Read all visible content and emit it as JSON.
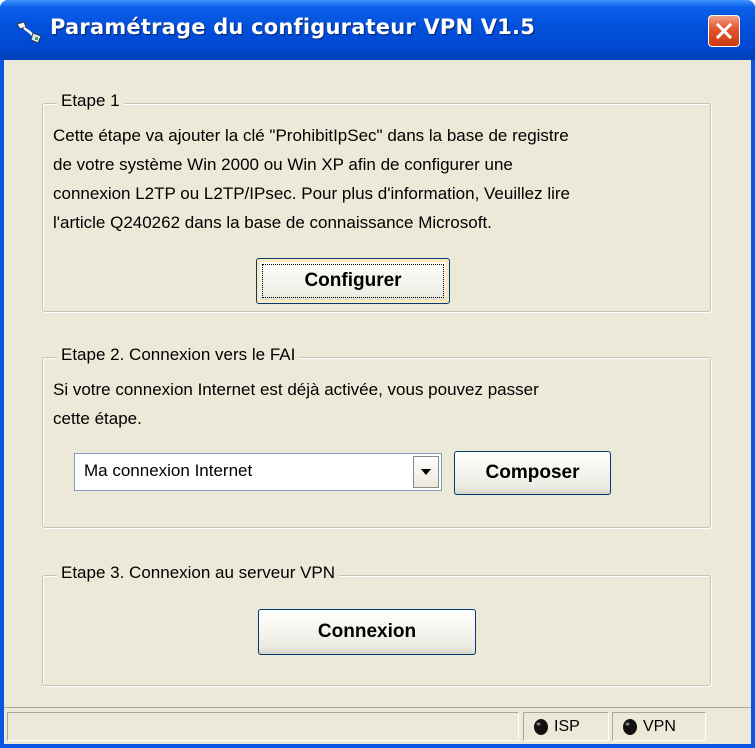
{
  "window": {
    "title": "Paramétrage du configurateur VPN V1.5",
    "icons": {
      "app": "vpn-app-icon",
      "close": "close-icon"
    }
  },
  "step1": {
    "legend": "Etape 1",
    "lines": [
      "Cette étape va ajouter la clé \"ProhibitIpSec\" dans la base de registre",
      "de votre système Win 2000 ou Win XP afin de configurer une",
      "connexion L2TP ou L2TP/IPsec. Pour plus d'information, Veuillez lire",
      "l'article Q240262 dans la base de connaissance Microsoft."
    ],
    "button_label": "Configurer"
  },
  "step2": {
    "legend": "Etape 2. Connexion vers le FAI",
    "lines": [
      "Si votre connexion Internet est déjà activée, vous pouvez passer",
      "cette étape."
    ],
    "connection_value": "Ma connexion Internet",
    "button_label": "Composer"
  },
  "step3": {
    "legend": "Etape 3. Connexion au serveur VPN",
    "button_label": "Connexion"
  },
  "statusbar": {
    "indicators": [
      {
        "label": "ISP",
        "icon": "led-off-icon"
      },
      {
        "label": "VPN",
        "icon": "led-off-icon"
      }
    ]
  },
  "colors": {
    "titlebar": "#0250dc",
    "dialog_bg": "#ece9d8",
    "close_button": "#e2582f",
    "led": "#111111"
  }
}
